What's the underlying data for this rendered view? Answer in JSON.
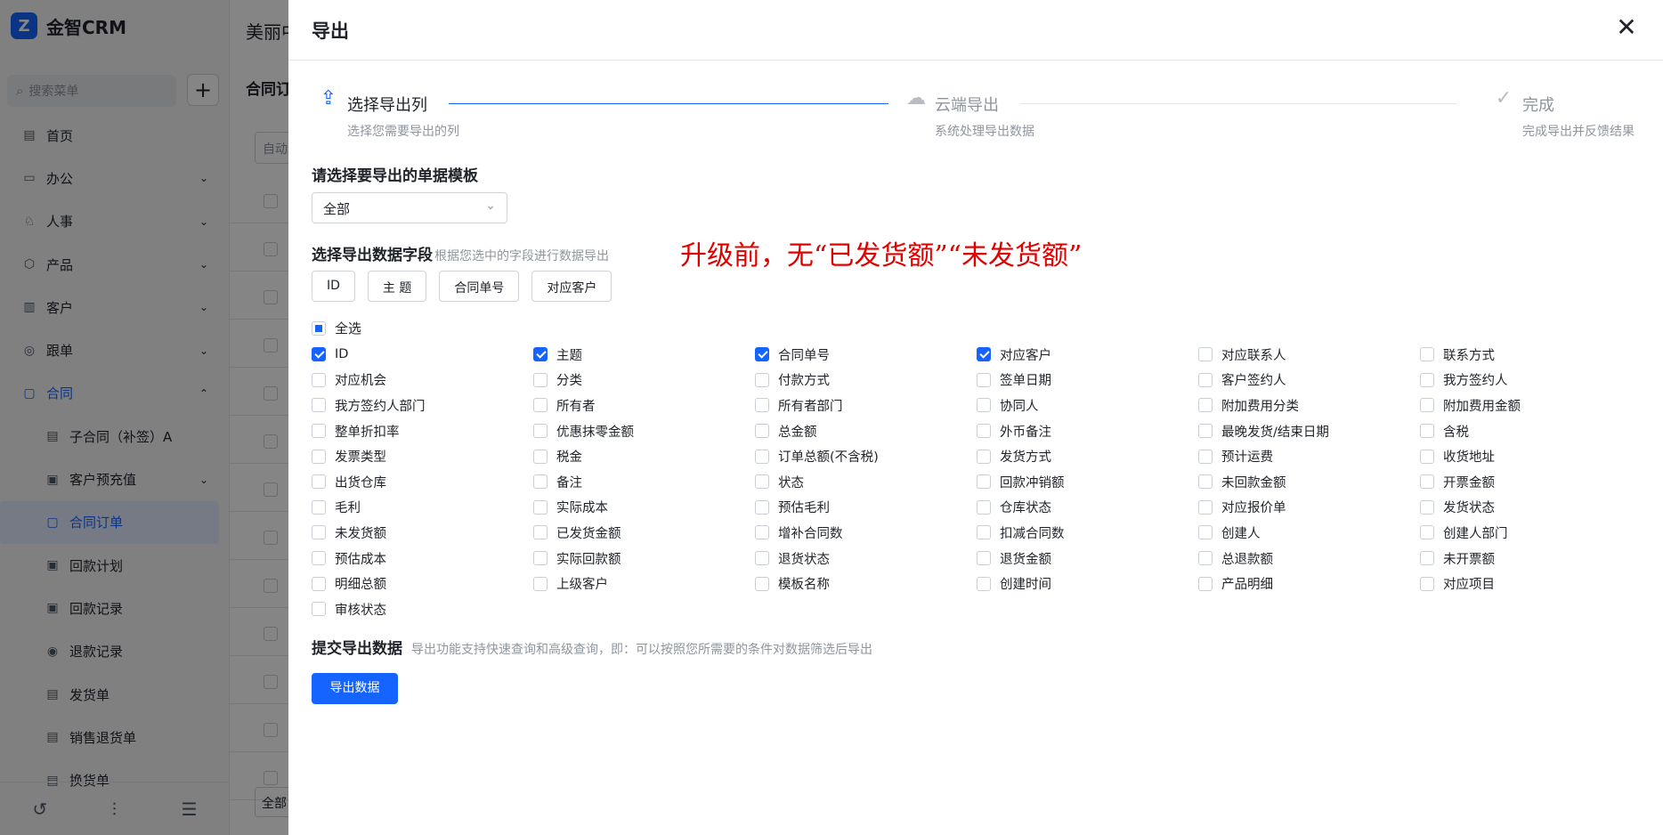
{
  "app": {
    "logo_letter": "Z",
    "name": "金智CRM"
  },
  "sidebar": {
    "search_placeholder": "搜索菜单",
    "add_label": "+",
    "items": [
      {
        "label": "首页",
        "icon": "home-icon",
        "glyph": "▤"
      },
      {
        "label": "办公",
        "icon": "office-icon",
        "glyph": "▭",
        "chevron": "⌄"
      },
      {
        "label": "人事",
        "icon": "people-icon",
        "glyph": "♘",
        "chevron": "⌄"
      },
      {
        "label": "产品",
        "icon": "cube-icon",
        "glyph": "⬡",
        "chevron": "⌄"
      },
      {
        "label": "客户",
        "icon": "customer-icon",
        "glyph": "▥",
        "chevron": "⌄"
      },
      {
        "label": "跟单",
        "icon": "follow-icon",
        "glyph": "◎",
        "chevron": "⌄"
      },
      {
        "label": "合同",
        "icon": "contract-icon",
        "glyph": "▢",
        "chevron": "⌃"
      },
      {
        "label": "子合同（补签）A",
        "icon": "subcontract-icon",
        "glyph": "▤"
      },
      {
        "label": "客户预充值",
        "icon": "prepay-icon",
        "glyph": "▣",
        "chevron": "⌄"
      },
      {
        "label": "合同订单",
        "icon": "order-icon",
        "glyph": "▢"
      },
      {
        "label": "回款计划",
        "icon": "plan-icon",
        "glyph": "▣"
      },
      {
        "label": "回款记录",
        "icon": "record-icon",
        "glyph": "▣"
      },
      {
        "label": "退款记录",
        "icon": "refund-icon",
        "glyph": "◉"
      },
      {
        "label": "发货单",
        "icon": "delivery-icon",
        "glyph": "▤"
      },
      {
        "label": "销售退货单",
        "icon": "return-icon",
        "glyph": "▤"
      },
      {
        "label": "换货单",
        "icon": "exchange-icon",
        "glyph": "▤"
      }
    ],
    "bottom_icons": [
      {
        "name": "history-icon",
        "glyph": "↺"
      },
      {
        "name": "settings-sliders-icon",
        "glyph": "⫶"
      },
      {
        "name": "collapse-menu-icon",
        "glyph": "☰"
      }
    ]
  },
  "background": {
    "title": "美丽中",
    "subtitle": "合同订",
    "filter_text": "自动",
    "footer_text": "全部"
  },
  "drawer": {
    "title": "导出",
    "close_glyph": "✕",
    "steps": [
      {
        "title": "选择导出列",
        "desc": "选择您需要导出的列",
        "glyph": "⇪",
        "icon": "cloud-upload-icon"
      },
      {
        "title": "云端导出",
        "desc": "系统处理导出数据",
        "glyph": "☁",
        "icon": "cloud-icon"
      },
      {
        "title": "完成",
        "desc": "完成导出并反馈结果",
        "glyph": "✓",
        "icon": "check-circle-icon"
      }
    ],
    "template_label": "请选择要导出的单据模板",
    "template_value": "全部",
    "template_arrow": "⌄",
    "fields_label": "选择导出数据字段",
    "fields_hint": "根据您选中的字段进行数据导出",
    "selected_chips": [
      "ID",
      "主 题",
      "合同单号",
      "对应客户"
    ],
    "select_all_label": "全选",
    "fields": [
      {
        "label": "ID",
        "checked": true
      },
      {
        "label": "主题",
        "checked": true
      },
      {
        "label": "合同单号",
        "checked": true
      },
      {
        "label": "对应客户",
        "checked": true
      },
      {
        "label": "对应联系人",
        "checked": false
      },
      {
        "label": "联系方式",
        "checked": false
      },
      {
        "label": "对应机会",
        "checked": false
      },
      {
        "label": "分类",
        "checked": false
      },
      {
        "label": "付款方式",
        "checked": false
      },
      {
        "label": "签单日期",
        "checked": false
      },
      {
        "label": "客户签约人",
        "checked": false
      },
      {
        "label": "我方签约人",
        "checked": false
      },
      {
        "label": "我方签约人部门",
        "checked": false
      },
      {
        "label": "所有者",
        "checked": false
      },
      {
        "label": "所有者部门",
        "checked": false
      },
      {
        "label": "协同人",
        "checked": false
      },
      {
        "label": "附加费用分类",
        "checked": false
      },
      {
        "label": "附加费用金额",
        "checked": false
      },
      {
        "label": "整单折扣率",
        "checked": false
      },
      {
        "label": "优惠抹零金额",
        "checked": false
      },
      {
        "label": "总金额",
        "checked": false
      },
      {
        "label": "外币备注",
        "checked": false
      },
      {
        "label": "最晚发货/结束日期",
        "checked": false
      },
      {
        "label": "含税",
        "checked": false
      },
      {
        "label": "发票类型",
        "checked": false
      },
      {
        "label": "税金",
        "checked": false
      },
      {
        "label": "订单总额(不含税)",
        "checked": false
      },
      {
        "label": "发货方式",
        "checked": false
      },
      {
        "label": "预计运费",
        "checked": false
      },
      {
        "label": "收货地址",
        "checked": false
      },
      {
        "label": "出货仓库",
        "checked": false
      },
      {
        "label": "备注",
        "checked": false
      },
      {
        "label": "状态",
        "checked": false
      },
      {
        "label": "回款冲销额",
        "checked": false
      },
      {
        "label": "未回款金额",
        "checked": false
      },
      {
        "label": "开票金额",
        "checked": false
      },
      {
        "label": "毛利",
        "checked": false
      },
      {
        "label": "实际成本",
        "checked": false
      },
      {
        "label": "预估毛利",
        "checked": false
      },
      {
        "label": "仓库状态",
        "checked": false
      },
      {
        "label": "对应报价单",
        "checked": false
      },
      {
        "label": "发货状态",
        "checked": false
      },
      {
        "label": "未发货额",
        "checked": false
      },
      {
        "label": "已发货金额",
        "checked": false
      },
      {
        "label": "增补合同数",
        "checked": false
      },
      {
        "label": "扣减合同数",
        "checked": false
      },
      {
        "label": "创建人",
        "checked": false
      },
      {
        "label": "创建人部门",
        "checked": false
      },
      {
        "label": "预估成本",
        "checked": false
      },
      {
        "label": "实际回款额",
        "checked": false
      },
      {
        "label": "退货状态",
        "checked": false
      },
      {
        "label": "退货金额",
        "checked": false
      },
      {
        "label": "总退款额",
        "checked": false
      },
      {
        "label": "未开票额",
        "checked": false
      },
      {
        "label": "明细总额",
        "checked": false
      },
      {
        "label": "上级客户",
        "checked": false
      },
      {
        "label": "模板名称",
        "checked": false
      },
      {
        "label": "创建时间",
        "checked": false
      },
      {
        "label": "产品明细",
        "checked": false
      },
      {
        "label": "对应项目",
        "checked": false
      },
      {
        "label": "审核状态",
        "checked": false
      }
    ],
    "submit_label": "提交导出数据",
    "submit_hint": "导出功能支持快速查询和高级查询，即：可以按照您所需要的条件对数据筛选后导出",
    "export_button": "导出数据"
  },
  "annotation": "升级前，无“已发货额”“未发货额”",
  "colors": {
    "accent": "#1664ff",
    "annotation": "#e00000"
  }
}
